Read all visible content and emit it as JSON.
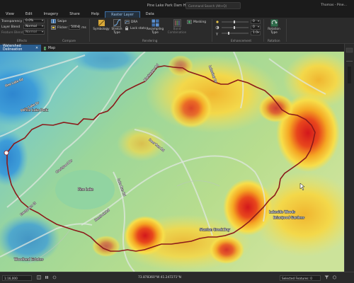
{
  "titlebar": {
    "title": "Pine Lake Park Dam H&H Analysis",
    "search_placeholder": "Command Search (Alt+Q)",
    "user": "Thomas - Pine..."
  },
  "menus": [
    "View",
    "Edit",
    "Imagery",
    "Share",
    "Help",
    "Raster Layer",
    "Data"
  ],
  "ribbon": {
    "effects": {
      "transparency_label": "Transparency",
      "transparency_value": "0.0%",
      "layer_blend_label": "Layer Blend",
      "layer_blend_value": "Normal",
      "feature_blend_label": "Feature Blend",
      "feature_blend_value": "Normal",
      "group_label": "Effects"
    },
    "compare": {
      "swipe_label": "Swipe",
      "flicker_label": "Flicker",
      "flicker_value": "500.0",
      "flicker_unit": "ms",
      "group_label": "Compare"
    },
    "rendering": {
      "symbology_label": "Symbology",
      "stretch_type_label": "Stretch Type",
      "dra_label": "DRA",
      "lock_stats_label": "Lock stats",
      "resampling_type_label": "Resampling Type",
      "band_combination_label": "Band Combination",
      "masking_label": "Masking",
      "group_label": "Rendering"
    },
    "enhancement": {
      "values": [
        "0",
        "0",
        "1.0"
      ],
      "group_label": "Enhancement"
    },
    "rotation": {
      "rotation_type_label": "Rotation Type",
      "group_label": "Rotation"
    }
  },
  "doc_tabs": [
    {
      "label": "Watershed Delineation",
      "active": true
    },
    {
      "label": "Map",
      "active": false
    }
  ],
  "map_labels": {
    "pine_lake": "Pine Lake",
    "roads": [
      "Pine Lake Rd",
      "Fawn Lake Dr",
      "Blackwater Rd",
      "Crestwood Dr",
      "Lake Run Rd",
      "Hemlock Rd",
      "Deer Run Rd",
      "Evergreen Ct",
      "Lakeview Dr"
    ],
    "places": [
      "Pine Lake Park",
      "Stanton Creek Bay",
      "Lakeside Woods",
      "Briarwood Gardens",
      "Woodland Estates"
    ]
  },
  "statusbar": {
    "scale": "1:16,000",
    "coordinates": "73.878360°W 41.247271°N",
    "selected_features": "Selected Features: 0"
  },
  "colors": {
    "watershed_outline": "#8b1a1a",
    "active_tab": "#2a5d8f",
    "context_tab": "#3d6fa5"
  }
}
